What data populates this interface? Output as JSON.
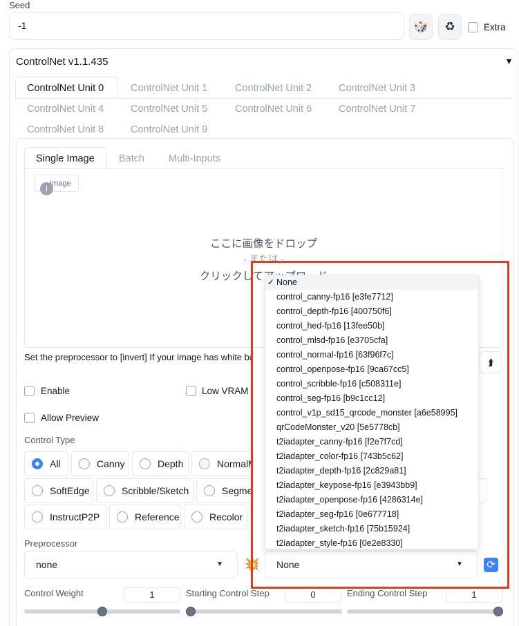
{
  "seed": {
    "label": "Seed",
    "value": "-1",
    "dice_icon": "🎲",
    "recycle_icon": "♻",
    "extra_label": "Extra"
  },
  "controlnet": {
    "title": "ControlNet v1.1.435",
    "caret": "▼",
    "units": [
      "ControlNet Unit 0",
      "ControlNet Unit 1",
      "ControlNet Unit 2",
      "ControlNet Unit 3",
      "ControlNet Unit 4",
      "ControlNet Unit 5",
      "ControlNet Unit 6",
      "ControlNet Unit 7",
      "ControlNet Unit 8",
      "ControlNet Unit 9"
    ]
  },
  "image_tabs": [
    "Single Image",
    "Batch",
    "Multi-Inputs"
  ],
  "image_chip": "Image",
  "drop": {
    "line1": "ここに画像をドロップ",
    "line2": "- または -",
    "line3": "クリックしてアップロード"
  },
  "note": "Set the preprocessor to [invert] If your image has white background and black lines.",
  "upload_icon": "⮭",
  "checkboxes": {
    "enable": "Enable",
    "low_vram": "Low VRAM",
    "allow_preview": "Allow Preview"
  },
  "control_type": {
    "label": "Control Type",
    "row1": [
      "All",
      "Canny",
      "Depth",
      "NormalMap"
    ],
    "row2": [
      "SoftEdge",
      "Scribble/Sketch",
      "Segmentation"
    ],
    "row3": [
      "InstructP2P",
      "Reference",
      "Recolor"
    ]
  },
  "preprocessor": {
    "label": "Preprocessor",
    "value": "none",
    "model_value": "None",
    "fire_icon": "💥",
    "refresh_icon": "⟳"
  },
  "sliders": [
    {
      "label": "Control Weight",
      "value": "1",
      "fraction": 0.5
    },
    {
      "label": "Starting Control Step",
      "value": "0",
      "fraction": 0.0
    },
    {
      "label": "Ending Control Step",
      "value": "1",
      "fraction": 1.0
    }
  ],
  "dropdown": {
    "selected_mark": "✓",
    "items": [
      "None",
      "control_canny-fp16 [e3fe7712]",
      "control_depth-fp16 [400750f6]",
      "control_hed-fp16 [13fee50b]",
      "control_mlsd-fp16 [e3705cfa]",
      "control_normal-fp16 [63f96f7c]",
      "control_openpose-fp16 [9ca67cc5]",
      "control_scribble-fp16 [c508311e]",
      "control_seg-fp16 [b9c1cc12]",
      "control_v1p_sd15_qrcode_monster [a6e58995]",
      "qrCodeMonster_v20 [5e5778cb]",
      "t2iadapter_canny-fp16 [f2e7f7cd]",
      "t2iadapter_color-fp16 [743b5c62]",
      "t2iadapter_depth-fp16 [2c829a81]",
      "t2iadapter_keypose-fp16 [e3943bb9]",
      "t2iadapter_openpose-fp16 [4286314e]",
      "t2iadapter_seg-fp16 [0e677718]",
      "t2iadapter_sketch-fp16 [75b15924]",
      "t2iadapter_style-fp16 [0e2e8330]"
    ]
  },
  "colors": {
    "highlight": "#e8391e",
    "radio_on": "#3b82f6"
  }
}
